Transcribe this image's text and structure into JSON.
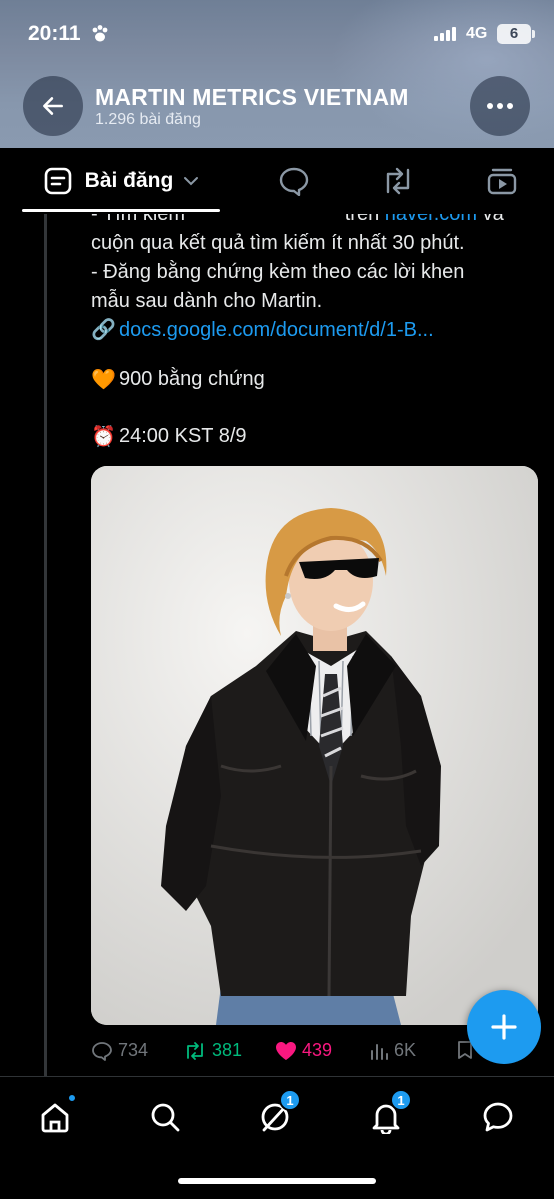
{
  "status_bar": {
    "time": "20:11",
    "network": "4G",
    "battery": "6"
  },
  "header": {
    "account_name": "MARTIN METRICS VIETNAM",
    "post_count": "1.296 bài đăng"
  },
  "tabs": {
    "posts_label": "Bài đăng",
    "icons": [
      "posts-icon",
      "replies-icon",
      "reposts-icon",
      "media-icon"
    ]
  },
  "post": {
    "cut_line_prefix": "- Tìm kiếm \"ᄆᄅᄐᄂ ᄆᄅᄂ\" trên ",
    "cut_line_link": "naver.com",
    "cut_line_suffix": " và",
    "line2": "cuộn qua kết quả tìm kiếm ít nhất 30 phút.",
    "line3": "- Đăng bằng chứng kèm theo các lời khen",
    "line4": "mẫu sau dành cho Martin.",
    "link_emoji": "🔗",
    "doc_link": "docs.google.com/document/d/1-B...",
    "goal_emoji": "🧡",
    "goal_text": "900 bằng chứng",
    "deadline_emoji": "⏰",
    "deadline_text": "24:00 KST 8/9",
    "stats": {
      "replies": "734",
      "reposts": "381",
      "likes": "439",
      "views": "6K"
    }
  },
  "bottom_nav": {
    "items": [
      "home-icon",
      "search-icon",
      "grok-icon",
      "notifications-icon",
      "messages-icon"
    ],
    "grok_badge": "1",
    "notifications_badge": "1"
  },
  "colors": {
    "accent": "#1d9bf0",
    "repost_green": "#00ba7c",
    "like_pink": "#f91880",
    "muted": "#71767b"
  }
}
